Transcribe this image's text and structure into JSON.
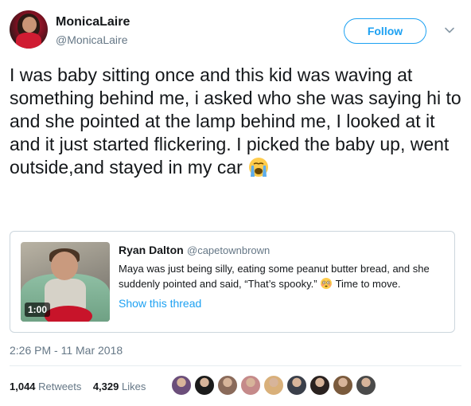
{
  "user": {
    "display_name": "MonicaLaire",
    "handle": "@MonicaLaire",
    "follow_label": "Follow"
  },
  "tweet": {
    "text": "I was baby sitting once and this kid was waving at something behind me, i asked who she was saying hi to and she pointed at the lamp behind me, I looked at it and it just started flickering. I picked the baby up, went outside,and stayed in my car",
    "emoji": "loudly-crying-face"
  },
  "quoted_tweet": {
    "display_name": "Ryan Dalton",
    "handle": "@capetownbrown",
    "text_before_emoji": "Maya was just being silly, eating some peanut butter bread, and she suddenly pointed and said, “That’s spooky.”",
    "emoji": "flushed-face",
    "text_after_emoji": "Time to move.",
    "video_duration": "1:00",
    "show_thread_label": "Show this thread"
  },
  "timestamp": "2:26 PM - 11 Mar 2018",
  "stats": {
    "retweets_count": "1,044",
    "retweets_label": "Retweets",
    "likes_count": "4,329",
    "likes_label": "Likes"
  },
  "colors": {
    "accent": "#1da1f2",
    "secondary_text": "#657786",
    "border": "#ccd6dd"
  },
  "likers": [
    {
      "name": "liker-avatar-1",
      "color": "#6b4e7a"
    },
    {
      "name": "liker-avatar-2",
      "color": "#1b1b1b"
    },
    {
      "name": "liker-avatar-3",
      "color": "#8a6a5a"
    },
    {
      "name": "liker-avatar-4",
      "color": "#c58a8a"
    },
    {
      "name": "liker-avatar-5",
      "color": "#d9b07a"
    },
    {
      "name": "liker-avatar-6",
      "color": "#3a3f4a"
    },
    {
      "name": "liker-avatar-7",
      "color": "#2a2220"
    },
    {
      "name": "liker-avatar-8",
      "color": "#7a5a3c"
    },
    {
      "name": "liker-avatar-9",
      "color": "#4a4a4a"
    }
  ]
}
